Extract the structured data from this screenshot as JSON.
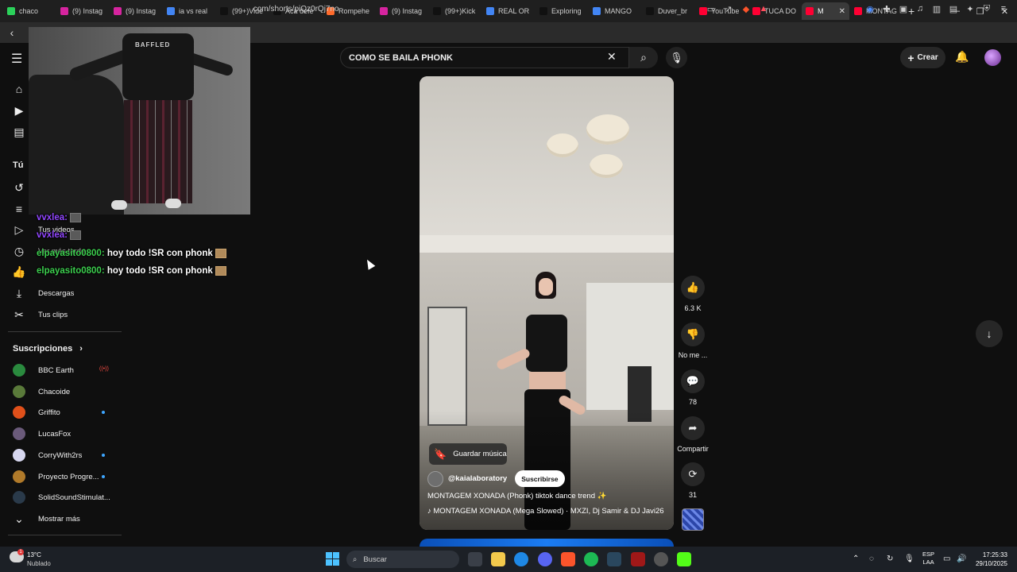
{
  "browser": {
    "tabs": [
      {
        "label": "chaco",
        "color": "#2bd15a"
      },
      {
        "label": "(9) Instag",
        "color": "#d6249f"
      },
      {
        "label": "(9) Instag",
        "color": "#d6249f"
      },
      {
        "label": "ia vs real",
        "color": "#4285f4"
      },
      {
        "label": "(99+)Vide",
        "color": "#111111"
      },
      {
        "label": "Acá defe",
        "color": "#111111"
      },
      {
        "label": "Rompehe",
        "color": "#ff6b2c"
      },
      {
        "label": "(9) Instag",
        "color": "#d6249f"
      },
      {
        "label": "(99+)Kick",
        "color": "#111111"
      },
      {
        "label": "REAL OR",
        "color": "#4285f4"
      },
      {
        "label": "Exploring",
        "color": "#111111"
      },
      {
        "label": "MANGO",
        "color": "#4285f4"
      },
      {
        "label": "Duver_br",
        "color": "#111111"
      },
      {
        "label": "YouTube",
        "color": "#ff0033"
      },
      {
        "label": "TUCA DO",
        "color": "#ff0033"
      },
      {
        "label": "M",
        "color": "#ff0033",
        "active": true
      },
      {
        "label": "MONTAG",
        "color": "#ff0033"
      }
    ],
    "url": ".com/shorts/piQz0rQj7no"
  },
  "youtube": {
    "search_value": "COMO SE BAILA PHONK",
    "create_label": "Crear"
  },
  "sidebar": {
    "you_label": "Tú",
    "items": [
      {
        "label": "Tus videos"
      },
      {
        "label": "Ver más tarde"
      },
      {
        "label": "Descargas"
      },
      {
        "label": "Tus clips"
      }
    ],
    "subs_title": "Suscripciones",
    "subscriptions": [
      {
        "name": "BBC Earth",
        "color": "#2a8a3e",
        "badge": "live"
      },
      {
        "name": "Chacoide",
        "color": "#5a7a3a",
        "badge": ""
      },
      {
        "name": "Griffito",
        "color": "#e0501a",
        "badge": "dot"
      },
      {
        "name": "LucasFox",
        "color": "#6a5a7a",
        "badge": ""
      },
      {
        "name": "CorryWith2rs",
        "color": "#d8d8f0",
        "badge": "dot"
      },
      {
        "name": "Proyecto Progre...",
        "color": "#b07a2a",
        "badge": "dot"
      },
      {
        "name": "SolidSoundStimulat...",
        "color": "#2a3a4a",
        "badge": ""
      }
    ],
    "show_more": "Mostrar más"
  },
  "webcam": {
    "shirt_text": "BAFFLED"
  },
  "chat": [
    {
      "user": "vvxlea:",
      "msg": "",
      "user_color": "purple"
    },
    {
      "user": "vvxlea:",
      "msg": "",
      "user_color": "purple"
    },
    {
      "user": "elpayasito0800:",
      "msg": " hoy todo !SR con phonk",
      "user_color": "green"
    },
    {
      "user": "elpayasito0800:",
      "msg": " hoy todo !SR con phonk",
      "user_color": "green"
    }
  ],
  "short": {
    "save_music": "Guardar música",
    "channel": "@kaialaboratory",
    "subscribe": "Suscribirse",
    "title": "MONTAGEM XONADA (Phonk) tiktok dance trend ✨",
    "music": "♪ MONTAGEM XONADA (Mega Slowed) · MXZI, Dj Samir & DJ Javi26",
    "likes": "6.3 K",
    "dislike": "No me ...",
    "comments": "78",
    "share": "Compartir",
    "remix": "31"
  },
  "taskbar": {
    "temp": "13°C",
    "weather": "Nublado",
    "weather_badge": "1",
    "search": "Buscar",
    "lang1": "ESP",
    "lang2": "LAA",
    "time": "17:25:33",
    "date": "29/10/2025"
  }
}
